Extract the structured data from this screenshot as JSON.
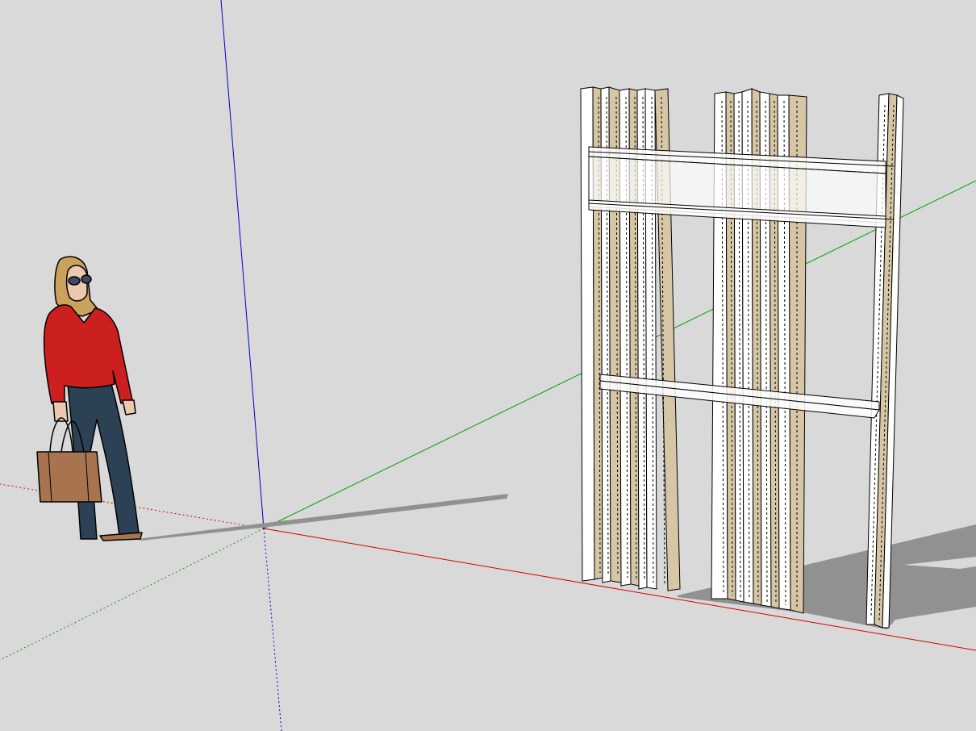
{
  "viewport": {
    "background_color": "#d9d9d9",
    "shadow_color": "#919191",
    "axis_colors": {
      "red": "#d40000",
      "green": "#00a000",
      "blue": "#0000c8"
    }
  },
  "person": {
    "icon": "person-figure-icon",
    "shirt_color": "#cc1f1f",
    "pants_color": "#2d4154",
    "bag_color": "#a87450",
    "hair_color": "#c9a35c",
    "skin_color": "#ecc8b0"
  },
  "model": {
    "icon": "wood-panel-frame-icon",
    "wood_color": "#d6c6a6",
    "face_color": "#ffffff",
    "edge_color": "#000000"
  }
}
